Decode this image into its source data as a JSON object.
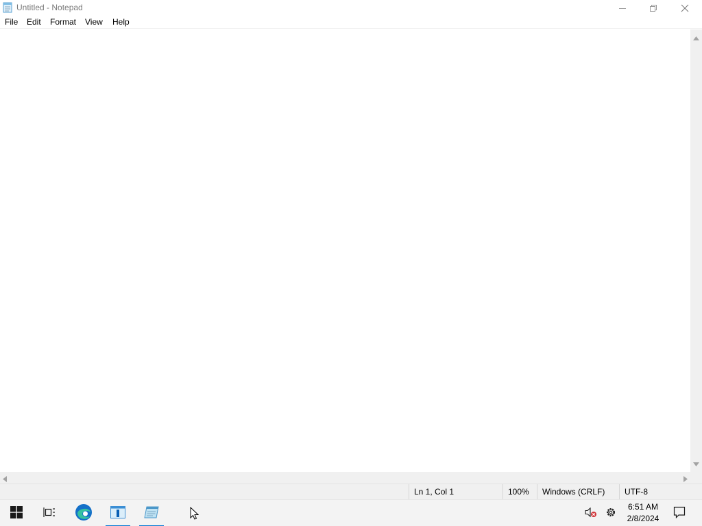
{
  "window": {
    "title": "Untitled - Notepad",
    "icons": {
      "app": "notepad-icon",
      "minimize": "minimize-icon",
      "maximize": "restore-icon",
      "close": "close-icon"
    }
  },
  "menu": {
    "file": "File",
    "edit": "Edit",
    "format": "Format",
    "view": "View",
    "help": "Help"
  },
  "editor": {
    "content": ""
  },
  "statusbar": {
    "position": "Ln 1, Col 1",
    "zoom": "100%",
    "line_ending": "Windows (CRLF)",
    "encoding": "UTF-8"
  },
  "taskbar": {
    "icons": [
      "windows-start-icon",
      "task-view-icon",
      "edge-icon",
      "app-window-icon",
      "notepad-icon"
    ],
    "tray_icons": [
      "volume-muted-icon",
      "settings-gear-icon",
      "notification-icon"
    ],
    "time": "6:51 AM",
    "date": "2/8/2024"
  },
  "colors": {
    "accent": "#0078d4",
    "taskbar_bg": "#f3f3f3",
    "statusbar_bg": "#f0f0f0",
    "title_text": "#7a7a7a"
  }
}
